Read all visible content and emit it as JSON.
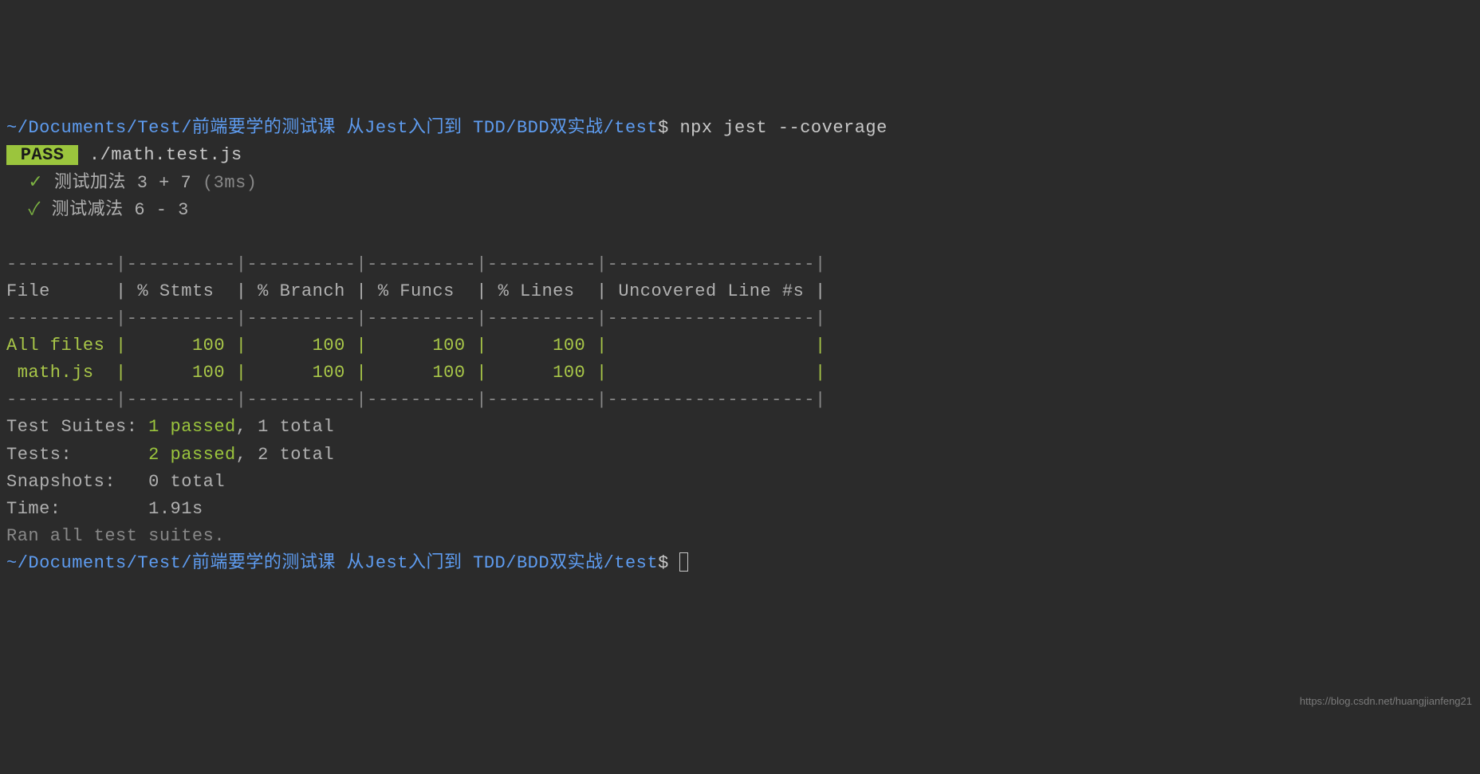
{
  "prompt_path": "~/Documents/Test/前端要学的测试课 从Jest入门到 TDD/BDD双实战/test",
  "dollar": "$",
  "command": "npx jest --coverage",
  "pass_label": " PASS ",
  "test_file": "./math.test.js",
  "tests": [
    {
      "check": "✓",
      "name": "测试加法 3 + 7",
      "time": " (3ms)"
    },
    {
      "check": "✓",
      "name": "测试减法 6 - 3",
      "time": ""
    }
  ],
  "table": {
    "border_top": "----------|----------|----------|----------|----------|-------------------|",
    "header": {
      "file": "File      ",
      "stmts": "| % Stmts  ",
      "branch": "| % Branch ",
      "funcs": "| % Funcs  ",
      "lines": "| % Lines  ",
      "uncov": "| Uncovered Line #s |"
    },
    "border_mid": "----------|----------|----------|----------|----------|-------------------|",
    "rows": [
      {
        "file": "All files ",
        "stmts": "|      100 ",
        "branch": "|      100 ",
        "funcs": "|      100 ",
        "lines": "|      100 ",
        "uncov": "|                   |"
      },
      {
        "file": " math.js  ",
        "stmts": "|      100 ",
        "branch": "|      100 ",
        "funcs": "|      100 ",
        "lines": "|      100 ",
        "uncov": "|                   |"
      }
    ],
    "border_bot": "----------|----------|----------|----------|----------|-------------------|"
  },
  "summary": {
    "suites_label": "Test Suites: ",
    "suites_pass": "1 passed",
    "suites_rest": ", 1 total",
    "tests_label": "Tests:       ",
    "tests_pass": "2 passed",
    "tests_rest": ", 2 total",
    "snaps_label": "Snapshots:   ",
    "snaps_val": "0 total",
    "time_label": "Time:        ",
    "time_val": "1.91s",
    "ran": "Ran all test suites."
  },
  "prompt2_path": "~/Documents/Test/前端要学的测试课 从Jest入门到 TDD/BDD双实战/test",
  "watermark": "https://blog.csdn.net/huangjianfeng21"
}
